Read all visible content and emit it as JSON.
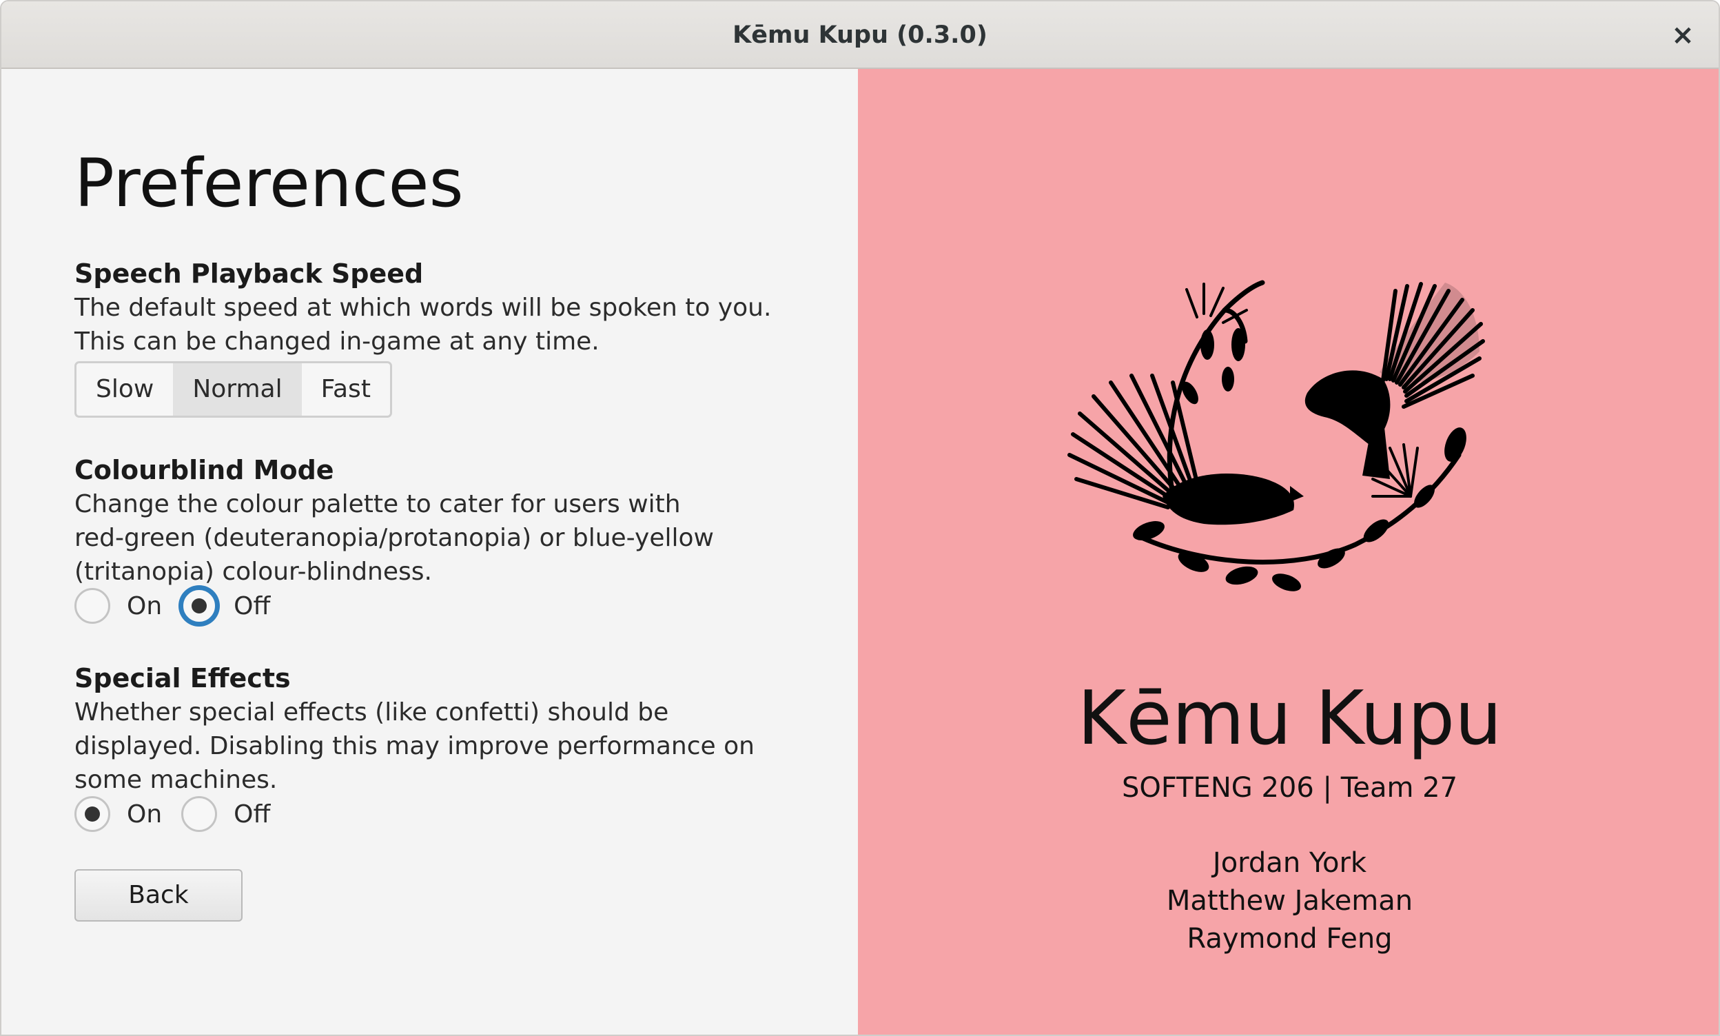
{
  "window": {
    "title": "Kēmu Kupu (0.3.0)",
    "close_glyph": "×"
  },
  "preferences": {
    "title": "Preferences",
    "speech": {
      "heading": "Speech Playback Speed",
      "description": "The default speed at which words will be spoken to you.\nThis can be changed in-game at any time.",
      "options": [
        "Slow",
        "Normal",
        "Fast"
      ],
      "selected": "Normal"
    },
    "colourblind": {
      "heading": "Colourblind Mode",
      "description": "Change the colour palette to cater for users with\nred-green (deuteranopia/protanopia) or blue-yellow\n(tritanopia) colour-blindness.",
      "on_label": "On",
      "off_label": "Off",
      "selected": "Off"
    },
    "effects": {
      "heading": "Special Effects",
      "description": "Whether special effects (like confetti) should be\ndisplayed. Disabling this may improve performance on\nsome machines.",
      "on_label": "On",
      "off_label": "Off",
      "selected": "On"
    },
    "back_label": "Back"
  },
  "about": {
    "app_name": "Kēmu Kupu",
    "subtitle": "SOFTENG 206 | Team 27",
    "authors": [
      "Jordan York",
      "Matthew Jakeman",
      "Raymond Feng"
    ],
    "logo_icon": "fantail-birds-logo",
    "background_color": "#f6a4a8"
  }
}
